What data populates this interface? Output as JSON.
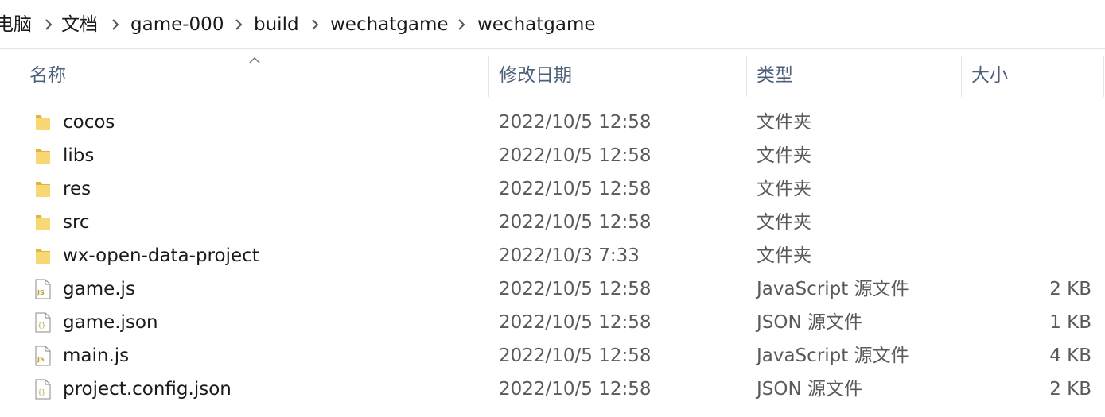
{
  "breadcrumb": {
    "items": [
      {
        "label": "电脑"
      },
      {
        "label": "文档"
      },
      {
        "label": "game-000"
      },
      {
        "label": "build"
      },
      {
        "label": "wechatgame"
      },
      {
        "label": "wechatgame"
      }
    ]
  },
  "columns": {
    "name": "名称",
    "modified": "修改日期",
    "type": "类型",
    "size": "大小"
  },
  "sort": {
    "column": "name",
    "direction": "ascending"
  },
  "files": [
    {
      "name": "cocos",
      "modified": "2022/10/5 12:58",
      "type": "文件夹",
      "size": "",
      "icon": "folder-icon"
    },
    {
      "name": "libs",
      "modified": "2022/10/5 12:58",
      "type": "文件夹",
      "size": "",
      "icon": "folder-icon"
    },
    {
      "name": "res",
      "modified": "2022/10/5 12:58",
      "type": "文件夹",
      "size": "",
      "icon": "folder-icon"
    },
    {
      "name": "src",
      "modified": "2022/10/5 12:58",
      "type": "文件夹",
      "size": "",
      "icon": "folder-icon"
    },
    {
      "name": "wx-open-data-project",
      "modified": "2022/10/3 7:33",
      "type": "文件夹",
      "size": "",
      "icon": "folder-icon"
    },
    {
      "name": "game.js",
      "modified": "2022/10/5 12:58",
      "type": "JavaScript 源文件",
      "size": "2 KB",
      "icon": "js-file-icon"
    },
    {
      "name": "game.json",
      "modified": "2022/10/5 12:58",
      "type": "JSON 源文件",
      "size": "1 KB",
      "icon": "json-file-icon"
    },
    {
      "name": "main.js",
      "modified": "2022/10/5 12:58",
      "type": "JavaScript 源文件",
      "size": "4 KB",
      "icon": "js-file-icon"
    },
    {
      "name": "project.config.json",
      "modified": "2022/10/5 12:58",
      "type": "JSON 源文件",
      "size": "2 KB",
      "icon": "json-file-icon"
    }
  ],
  "colors": {
    "header_text": "#4c607a",
    "folder_yellow": "#f8d775",
    "folder_dark": "#e0b53a",
    "js_badge": "#b5a235"
  }
}
